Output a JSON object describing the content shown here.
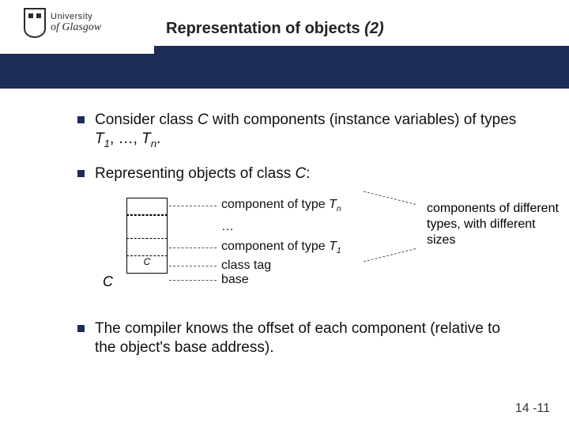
{
  "logo": {
    "line1": "University",
    "line2": "of Glasgow"
  },
  "title": {
    "prefix": "Representation of objects ",
    "suffix": "(2)"
  },
  "bullets": {
    "b1a": "Consider class ",
    "b1b": "C",
    "b1c": " with components (instance variables) of types ",
    "b1d": "T",
    "b1e": ", …, ",
    "b1f": "T",
    "b1g": ".",
    "sub1": "1",
    "subn": "n",
    "b2a": "Representing objects of class ",
    "b2b": "C",
    "b2c": ":",
    "b3": "The compiler knows the offset of each component (relative to the object's base address)."
  },
  "diagram": {
    "classTagCell": "C",
    "classTagSide": "C",
    "ann_tn_a": "component of type ",
    "ann_tn_b": "T",
    "ann_tn_sub": "n",
    "ellipsis": "…",
    "ann_t1_a": "component of type ",
    "ann_t1_b": "T",
    "ann_t1_sub": "1",
    "ann_classtag": "class tag",
    "ann_base": "base",
    "rightnote": "components of different types, with different sizes"
  },
  "page": "14 -11"
}
